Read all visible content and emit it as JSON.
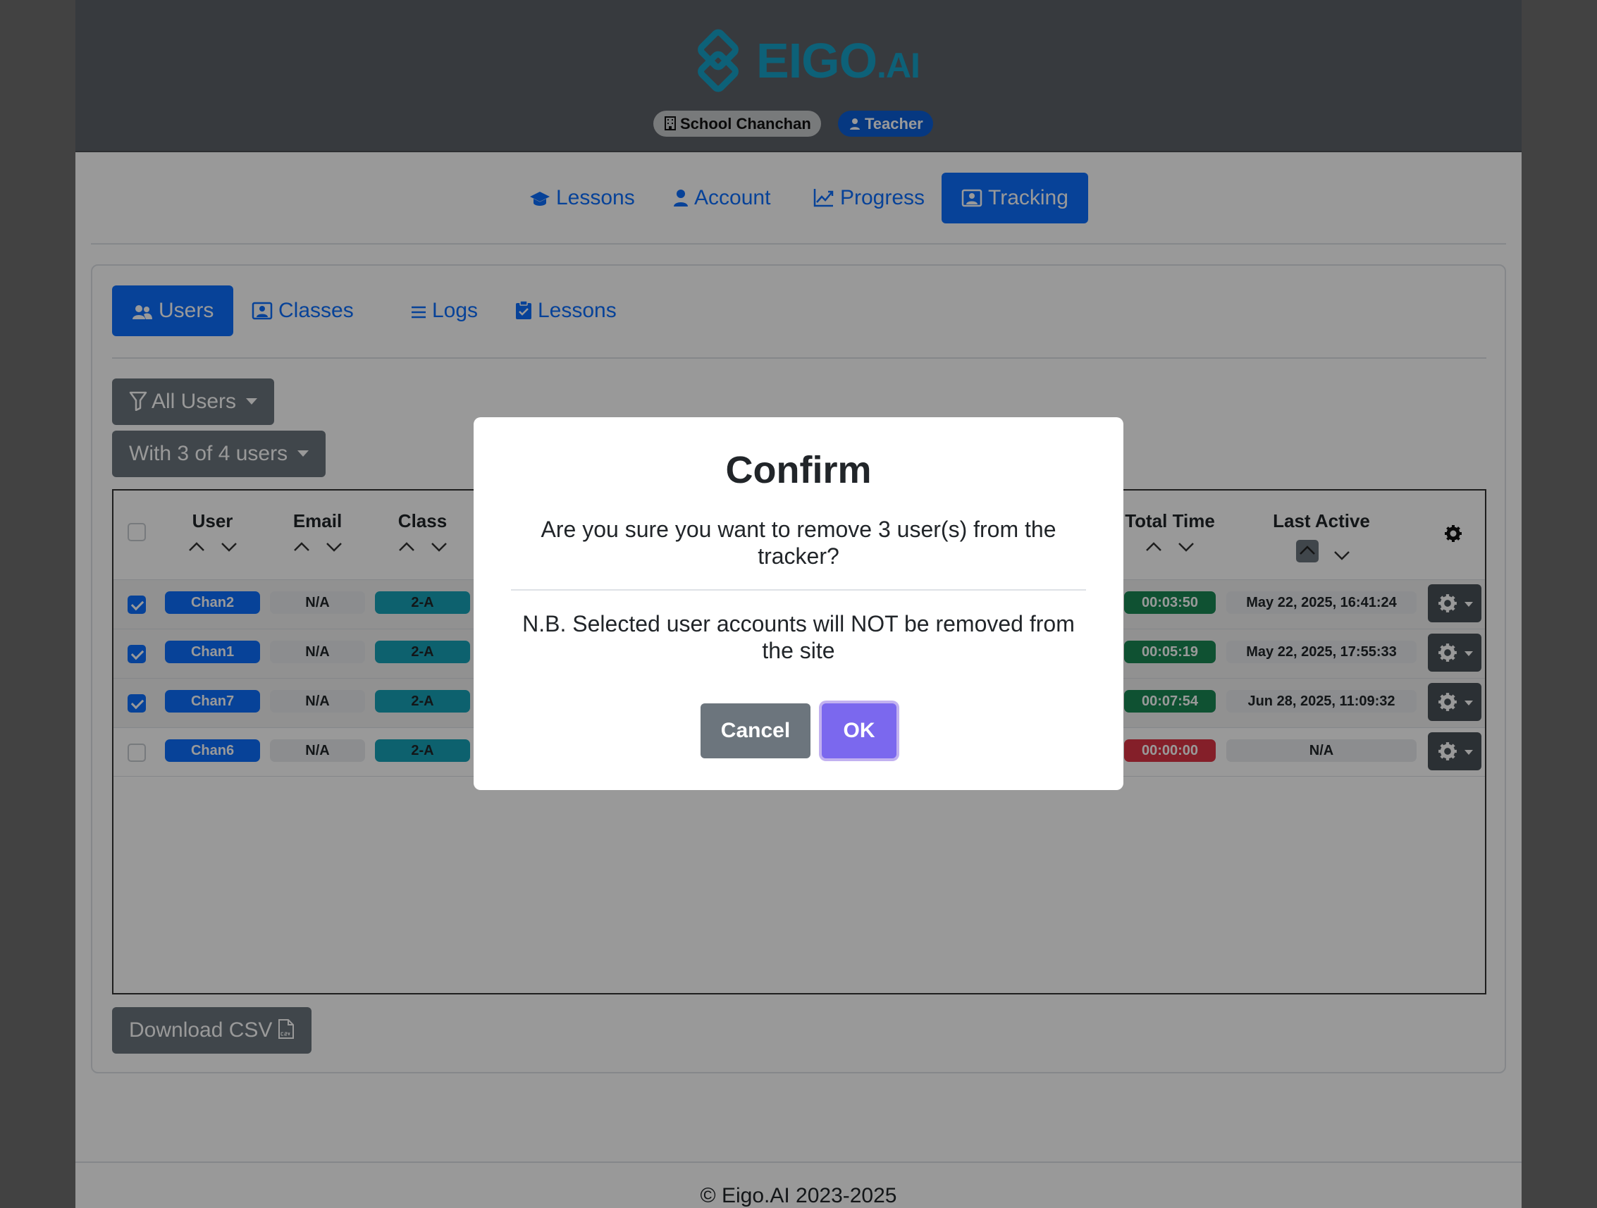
{
  "header": {
    "logo_text": "EIGO",
    "logo_suffix": ".AI",
    "school_badge": "School Chanchan",
    "role_badge": "Teacher"
  },
  "main_nav": {
    "items": [
      {
        "label": "Lessons",
        "icon": "graduation-cap-icon"
      },
      {
        "label": "Account",
        "icon": "person-icon"
      },
      {
        "label": "Progress",
        "icon": "graph-up-icon"
      },
      {
        "label": "Tracking",
        "icon": "person-video-icon",
        "active": true
      }
    ]
  },
  "sub_nav": {
    "items": [
      {
        "label": "Users",
        "icon": "people-icon",
        "active": true
      },
      {
        "label": "Classes",
        "icon": "person-video-icon"
      },
      {
        "label": "Logs",
        "icon": "list-icon"
      },
      {
        "label": "Lessons",
        "icon": "clipboard-check-icon"
      }
    ]
  },
  "filters": {
    "filter_label": "All Users",
    "count_label": "With 3 of 4 users"
  },
  "table": {
    "columns": [
      "User",
      "Email",
      "Class",
      "Total Time",
      "Last Active"
    ],
    "rows": [
      {
        "selected": true,
        "user": "Chan2",
        "email": "N/A",
        "class": "2-A",
        "total_time": "00:03:50",
        "last_active": "May 22, 2025, 16:41:24"
      },
      {
        "selected": true,
        "user": "Chan1",
        "email": "N/A",
        "class": "2-A",
        "total_time": "00:05:19",
        "last_active": "May 22, 2025, 17:55:33"
      },
      {
        "selected": true,
        "user": "Chan7",
        "email": "N/A",
        "class": "2-A",
        "total_time": "00:07:54",
        "last_active": "Jun 28, 2025, 11:09:32"
      },
      {
        "selected": false,
        "user": "Chan6",
        "email": "N/A",
        "class": "2-A",
        "total_time": "00:00:00",
        "last_active": "N/A"
      }
    ]
  },
  "csv_button": "Download CSV",
  "footer": "© Eigo.AI 2023-2025",
  "modal": {
    "title": "Confirm",
    "message": "Are you sure you want to remove 3 user(s) from the tracker?",
    "note": "N.B. Selected user accounts will NOT be removed from the site",
    "cancel": "Cancel",
    "ok": "OK"
  },
  "colors": {
    "primary": "#0d6efd",
    "time_ok": "#198754",
    "time_zero": "#dc3545",
    "class_pill": "#17a2b8",
    "ok_button": "#7b68ee"
  }
}
